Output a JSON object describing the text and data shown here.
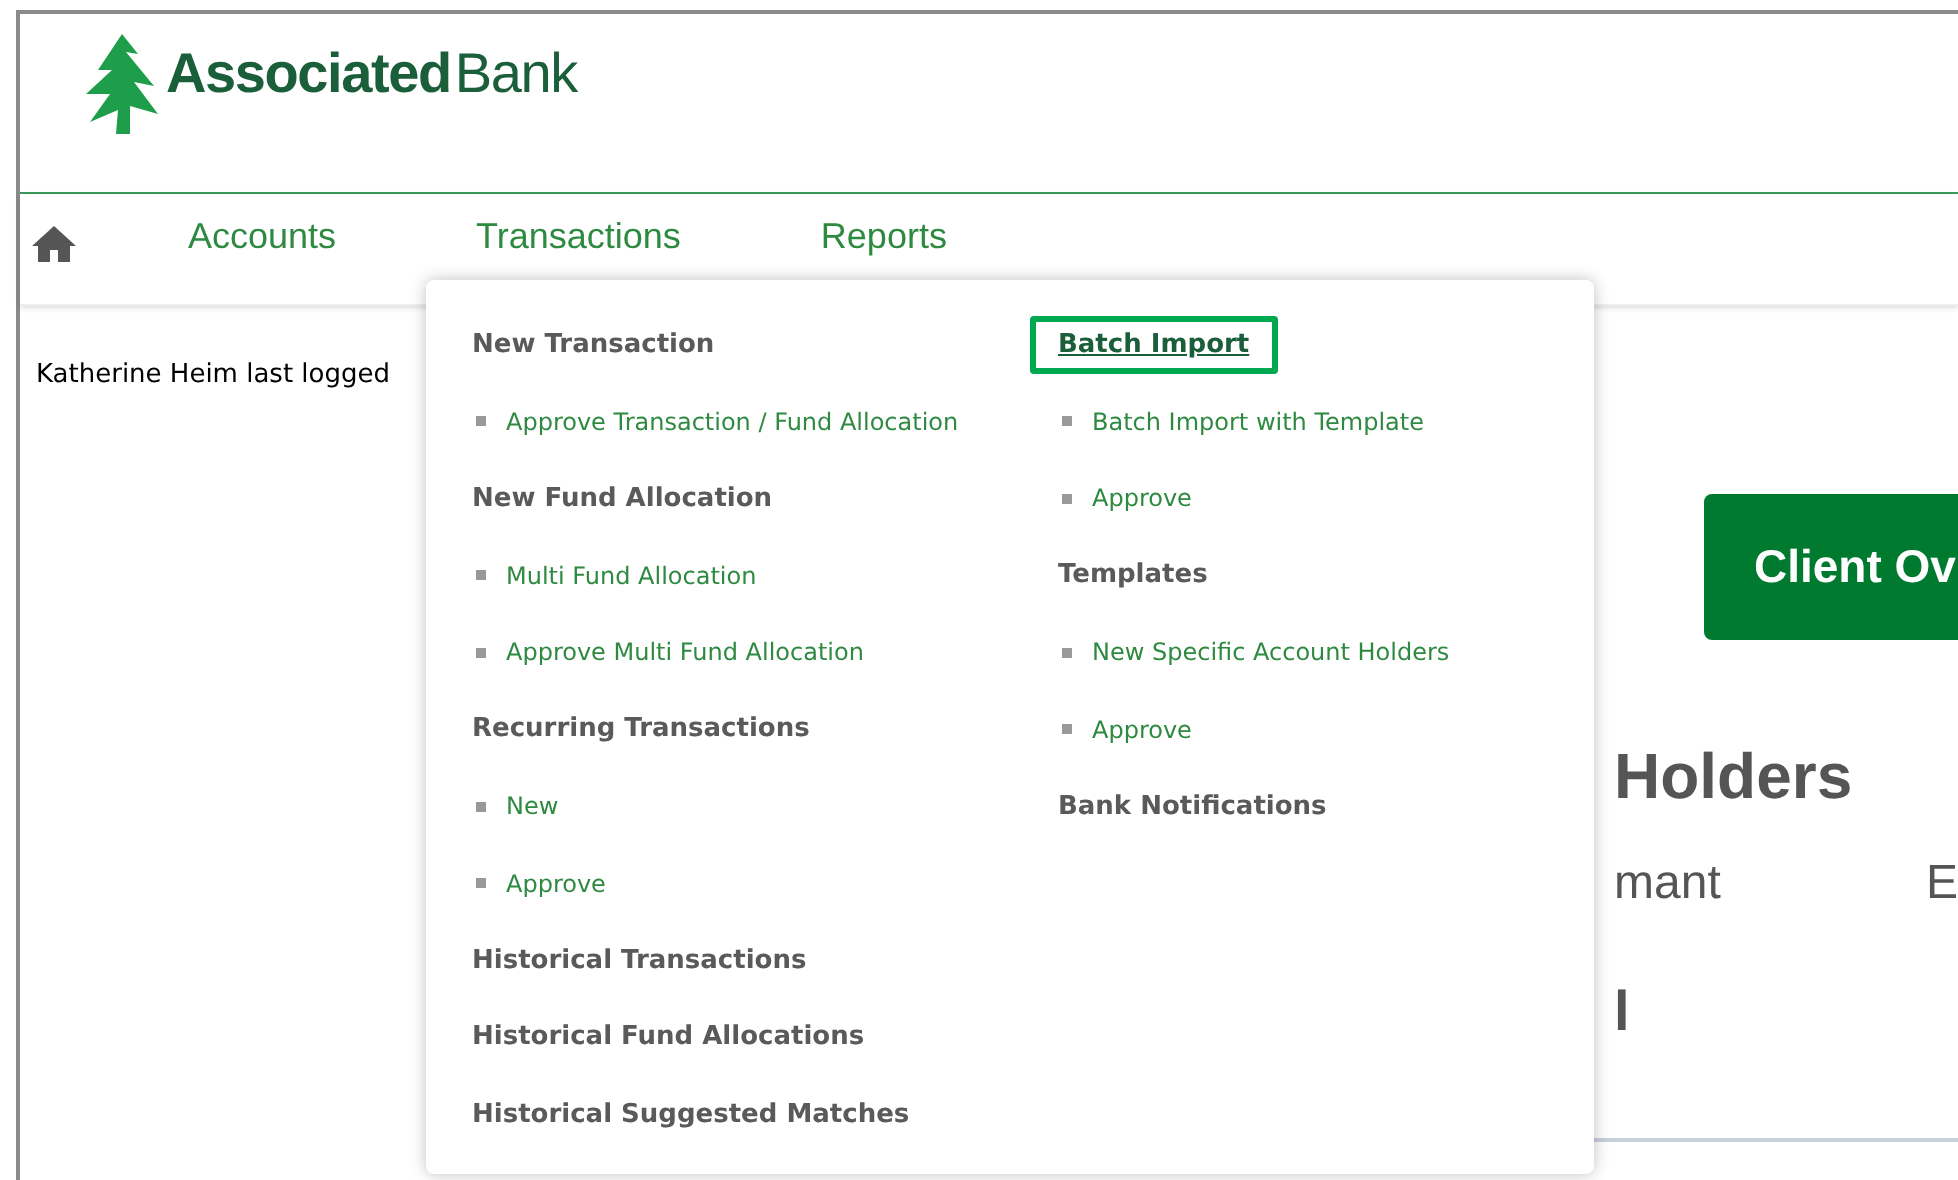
{
  "logo": {
    "bold": "Associated",
    "regular": "Bank"
  },
  "nav": [
    {
      "label": "Accounts"
    },
    {
      "label": "Transactions"
    },
    {
      "label": "Reports"
    }
  ],
  "last_login": "Katherine Heim last logged",
  "card": {
    "button": "Client Ov",
    "heading": "Holders",
    "column_1": "mant",
    "column_2": "E",
    "value": "l"
  },
  "menu": {
    "columns": [
      [
        {
          "kind": "heading",
          "label": "New Transaction",
          "highlighted": false
        },
        {
          "kind": "link",
          "label": "Approve Transaction / Fund Allocation",
          "highlighted": false
        },
        {
          "kind": "heading",
          "label": "New Fund Allocation",
          "highlighted": false
        },
        {
          "kind": "link",
          "label": "Multi Fund Allocation",
          "highlighted": false
        },
        {
          "kind": "link",
          "label": "Approve Multi Fund Allocation",
          "highlighted": false
        },
        {
          "kind": "heading",
          "label": "Recurring Transactions",
          "highlighted": false
        },
        {
          "kind": "link",
          "label": "New",
          "highlighted": false
        },
        {
          "kind": "link",
          "label": "Approve",
          "highlighted": false
        },
        {
          "kind": "heading",
          "label": "Historical Transactions",
          "highlighted": false
        },
        {
          "kind": "heading",
          "label": "Historical Fund Allocations",
          "highlighted": false
        },
        {
          "kind": "heading",
          "label": "Historical Suggested Matches",
          "highlighted": false
        }
      ],
      [
        {
          "kind": "heading",
          "label": "Batch Import",
          "highlighted": true
        },
        {
          "kind": "link",
          "label": "Batch Import with Template",
          "highlighted": false
        },
        {
          "kind": "link",
          "label": "Approve",
          "highlighted": false
        },
        {
          "kind": "heading",
          "label": "Templates",
          "highlighted": false
        },
        {
          "kind": "link",
          "label": "New Specific Account Holders",
          "highlighted": false
        },
        {
          "kind": "link",
          "label": "Approve",
          "highlighted": false
        },
        {
          "kind": "heading",
          "label": "Bank Notifications",
          "highlighted": false
        }
      ]
    ]
  }
}
